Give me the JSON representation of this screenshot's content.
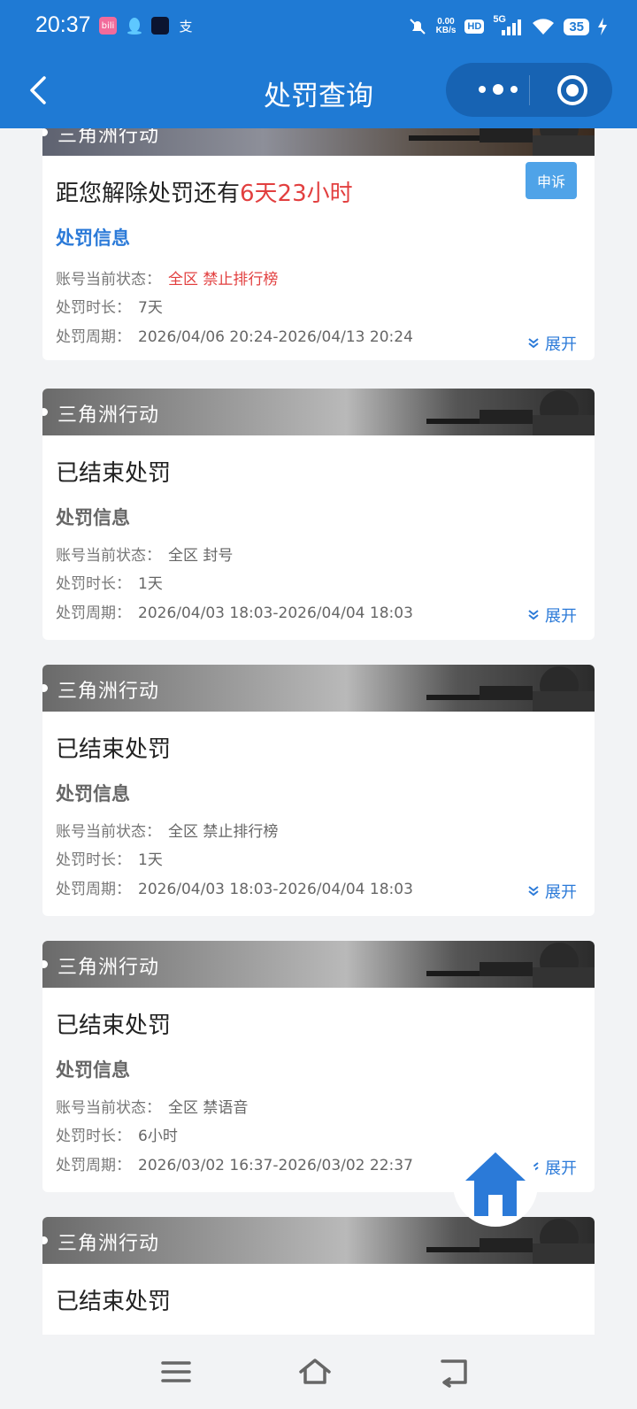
{
  "status_bar": {
    "time": "20:37",
    "apps": [
      "bilibili-icon",
      "qq-icon",
      "app-icon",
      "alipay-icon"
    ],
    "alipay_glyph": "支",
    "bili_glyph": "bili",
    "net_speed_value": "0.00",
    "net_speed_unit": "KB/s",
    "hd": "HD",
    "signal": "5G",
    "battery": "35"
  },
  "nav": {
    "title": "处罚查询"
  },
  "cards": [
    {
      "game": "三角洲行动",
      "title_prefix": "距您解除处罚还有",
      "title_highlight": "6天23小时",
      "appeal": "申诉",
      "section": "处罚信息",
      "status_label": "账号当前状态：",
      "status_value": "全区 禁止排行榜",
      "duration_label": "处罚时长：",
      "duration_value": "7天",
      "period_label": "处罚周期：",
      "period_value": "2026/04/06 20:24-2026/04/13 20:24",
      "expand": "展开"
    },
    {
      "game": "三角洲行动",
      "title": "已结束处罚",
      "section": "处罚信息",
      "status_label": "账号当前状态：",
      "status_value": "全区 封号",
      "duration_label": "处罚时长：",
      "duration_value": "1天",
      "period_label": "处罚周期：",
      "period_value": "2026/04/03 18:03-2026/04/04 18:03",
      "expand": "展开"
    },
    {
      "game": "三角洲行动",
      "title": "已结束处罚",
      "section": "处罚信息",
      "status_label": "账号当前状态：",
      "status_value": "全区 禁止排行榜",
      "duration_label": "处罚时长：",
      "duration_value": "1天",
      "period_label": "处罚周期：",
      "period_value": "2026/04/03 18:03-2026/04/04 18:03",
      "expand": "展开"
    },
    {
      "game": "三角洲行动",
      "title": "已结束处罚",
      "section": "处罚信息",
      "status_label": "账号当前状态：",
      "status_value": "全区 禁语音",
      "duration_label": "处罚时长：",
      "duration_value": "6小时",
      "period_label": "处罚周期：",
      "period_value": "2026/03/02 16:37-2026/03/02 22:37",
      "expand": "展开"
    },
    {
      "game": "三角洲行动",
      "title": "已结束处罚"
    }
  ],
  "colors": {
    "header": "#1f7ad4",
    "accent": "#2b7ad8",
    "alert": "#e23f3f",
    "appeal_button": "#4fa3e8"
  }
}
